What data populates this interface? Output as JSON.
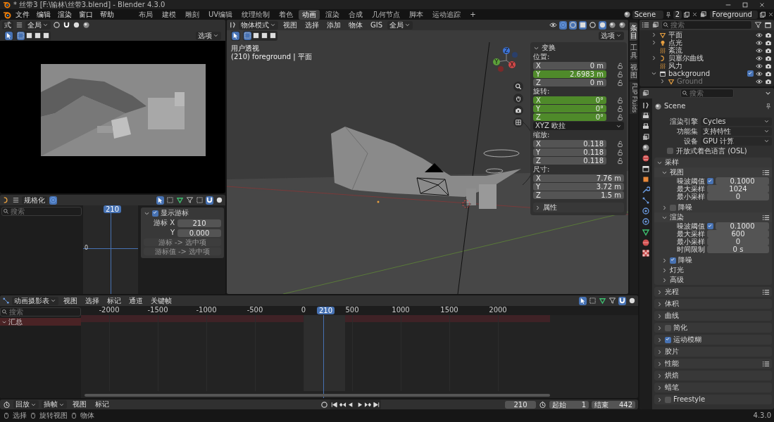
{
  "window": {
    "title": "* 丝带3 [F:\\输林\\丝带3.blend] - Blender 4.3.0"
  },
  "menu": [
    "文件",
    "编辑",
    "渲染",
    "窗口",
    "帮助"
  ],
  "workspaces": [
    {
      "label": "布局",
      "selected": false
    },
    {
      "label": "建模",
      "selected": false
    },
    {
      "label": "雕刻",
      "selected": false
    },
    {
      "label": "UV编辑",
      "selected": false
    },
    {
      "label": "纹理绘制",
      "selected": false
    },
    {
      "label": "着色",
      "selected": false
    },
    {
      "label": "动画",
      "selected": true
    },
    {
      "label": "渲染",
      "selected": false
    },
    {
      "label": "合成",
      "selected": false
    },
    {
      "label": "几何节点",
      "selected": false
    },
    {
      "label": "脚本",
      "selected": false
    },
    {
      "label": "运动追踪",
      "selected": false
    }
  ],
  "add_workspace": "+",
  "scene": {
    "name": "Scene",
    "users": "2"
  },
  "view_layer": {
    "name": "Foreground"
  },
  "camera_view": {
    "mode": "式",
    "orientation": "全局",
    "options": "选项"
  },
  "viewport": {
    "mode": "物体模式",
    "menus": [
      "视图",
      "选择",
      "添加",
      "物体",
      "GIS"
    ],
    "orientation": "全局",
    "options": "选项",
    "view_name": "用户透视",
    "view_info": "(210) foreground | 平面",
    "gizmo": [
      "Z",
      "Y",
      "X"
    ]
  },
  "transform": {
    "title": "变换",
    "groups": [
      {
        "kind": "vector",
        "label": "位置:",
        "lockable": true,
        "rows": [
          {
            "axis": "X",
            "value": "0 m",
            "animated": false
          },
          {
            "axis": "Y",
            "value": "2.6983 m",
            "animated": true
          },
          {
            "axis": "Z",
            "value": "0 m",
            "animated": false
          }
        ]
      },
      {
        "kind": "vector",
        "label": "旋转:",
        "lockable": true,
        "rows": [
          {
            "axis": "X",
            "value": "0°",
            "animated": true
          },
          {
            "axis": "Y",
            "value": "0°",
            "animated": true
          },
          {
            "axis": "Z",
            "value": "0°",
            "animated": true
          }
        ]
      },
      {
        "kind": "dropdown",
        "value": "XYZ 欧拉"
      },
      {
        "kind": "vector",
        "label": "缩放:",
        "lockable": true,
        "rows": [
          {
            "axis": "X",
            "value": "0.118",
            "animated": false
          },
          {
            "axis": "Y",
            "value": "0.118",
            "animated": false
          },
          {
            "axis": "Z",
            "value": "0.118",
            "animated": false
          }
        ]
      },
      {
        "kind": "vector",
        "label": "尺寸:",
        "lockable": false,
        "rows": [
          {
            "axis": "X",
            "value": "7.76 m",
            "animated": false
          },
          {
            "axis": "Y",
            "value": "3.72 m",
            "animated": false
          },
          {
            "axis": "Z",
            "value": "1.5 m",
            "animated": false
          }
        ]
      }
    ],
    "collapsed_panel": "属性"
  },
  "side_tabs": [
    {
      "label": "条目",
      "kind": "cjk",
      "selected": true
    },
    {
      "label": "工具",
      "kind": "cjk",
      "selected": false
    },
    {
      "label": "视图",
      "kind": "cjk",
      "selected": false
    },
    {
      "label": "FLIP Fluids",
      "kind": "latin",
      "selected": false
    }
  ],
  "graph_editor": {
    "mode": "规格化",
    "search_placeholder": "搜索",
    "frame": "210",
    "zero_label": "0",
    "cursor_panel": {
      "title": "显示游标",
      "checked": true,
      "fields": [
        {
          "label": "游标 X",
          "value": "210"
        },
        {
          "label": "Y",
          "value": "0.000"
        }
      ],
      "buttons": [
        "游标 -> 选中项",
        "游标值 -> 选中项"
      ]
    }
  },
  "outliner": {
    "search_placeholder": "搜索",
    "items": [
      {
        "name": "平面",
        "kind": "mesh",
        "expanded": false,
        "dimmed": false
      },
      {
        "name": "点光",
        "kind": "light",
        "expanded": false,
        "dimmed": false
      },
      {
        "name": "紊流",
        "kind": "force",
        "dimmed": false
      },
      {
        "name": "贝塞尔曲线",
        "kind": "curve",
        "expanded": false,
        "dimmed": false
      },
      {
        "name": "风力",
        "kind": "force",
        "dimmed": false
      },
      {
        "name": "background",
        "kind": "collection",
        "expanded": true,
        "dimmed": false,
        "checked": true,
        "children": [
          {
            "name": "Ground",
            "kind": "mesh",
            "expanded": false,
            "dimmed": true
          }
        ]
      }
    ]
  },
  "properties": {
    "search_placeholder": "搜索",
    "context": "Scene",
    "fields": [
      {
        "label": "渲染引擎",
        "value": "Cycles"
      },
      {
        "label": "功能集",
        "value": "支持特性"
      },
      {
        "label": "设备",
        "value": "GPU 计算"
      }
    ],
    "osl": {
      "label": "开放式着色语言 (OSL)",
      "checked": false
    },
    "panels": [
      {
        "title": "采样",
        "kind": "plain",
        "expanded": true,
        "presets": false,
        "subpanels": [
          {
            "title": "视图",
            "kind": "plain",
            "expanded": true,
            "presets": true,
            "rows": [
              {
                "kind": "check-number",
                "label": "噪波阈值",
                "checked": true,
                "value": "0.1000"
              },
              {
                "kind": "number",
                "label": "最大采样",
                "value": "1024"
              },
              {
                "kind": "number",
                "label": "最小采样",
                "value": "0"
              }
            ]
          },
          {
            "title": "降噪",
            "kind": "toggle",
            "checked": false,
            "expanded": false,
            "presets": false
          },
          {
            "title": "渲染",
            "kind": "plain",
            "expanded": true,
            "presets": true,
            "rows": [
              {
                "kind": "check-number",
                "label": "噪波阈值",
                "checked": true,
                "value": "0.1000"
              },
              {
                "kind": "number",
                "label": "最大采样",
                "value": "600"
              },
              {
                "kind": "number",
                "label": "最小采样",
                "value": "0"
              },
              {
                "kind": "number",
                "label": "时间限制",
                "value": "0 s"
              }
            ]
          },
          {
            "title": "降噪",
            "kind": "toggle",
            "checked": true,
            "expanded": false,
            "presets": false
          },
          {
            "title": "灯光",
            "kind": "plain",
            "expanded": false,
            "presets": false
          },
          {
            "title": "高级",
            "kind": "plain",
            "expanded": false,
            "presets": false
          }
        ]
      },
      {
        "title": "光程",
        "kind": "plain",
        "expanded": false,
        "presets": true
      },
      {
        "title": "体积",
        "kind": "plain",
        "expanded": false,
        "presets": false
      },
      {
        "title": "曲线",
        "kind": "plain",
        "expanded": false,
        "presets": false
      },
      {
        "title": "简化",
        "kind": "toggle",
        "checked": false,
        "expanded": false,
        "presets": false
      },
      {
        "title": "运动模糊",
        "kind": "toggle",
        "checked": true,
        "expanded": false,
        "presets": false
      },
      {
        "title": "胶片",
        "kind": "plain",
        "expanded": false,
        "presets": false
      },
      {
        "title": "性能",
        "kind": "plain",
        "expanded": false,
        "presets": true
      },
      {
        "title": "烘焙",
        "kind": "plain",
        "expanded": false,
        "presets": false
      },
      {
        "title": "蜡笔",
        "kind": "plain",
        "expanded": false,
        "presets": false
      },
      {
        "title": "Freestyle",
        "kind": "toggle",
        "checked": false,
        "expanded": false,
        "presets": false
      }
    ]
  },
  "dope_sheet": {
    "mode": "动画摄影表",
    "menus": [
      "视图",
      "选择",
      "标记",
      "通道",
      "关键帧"
    ],
    "search_placeholder": "搜索",
    "ticks": [
      "-2000",
      "-1500",
      "-1000",
      "-500",
      "0",
      "500",
      "1000",
      "1500",
      "2000"
    ],
    "frame": "210",
    "summary": "汇总"
  },
  "timeline": {
    "menus": [
      {
        "label": "回放",
        "dropdown": true
      },
      {
        "label": "插帧",
        "dropdown": true
      },
      {
        "label": "视图",
        "dropdown": false
      },
      {
        "label": "标记",
        "dropdown": false
      }
    ],
    "current_frame": "210",
    "start_label": "起始",
    "start": "1",
    "end_label": "结束",
    "end": "442"
  },
  "status_bar": {
    "hints": [
      "选择",
      "旋转视图",
      "物体"
    ],
    "version": "4.3.0"
  }
}
